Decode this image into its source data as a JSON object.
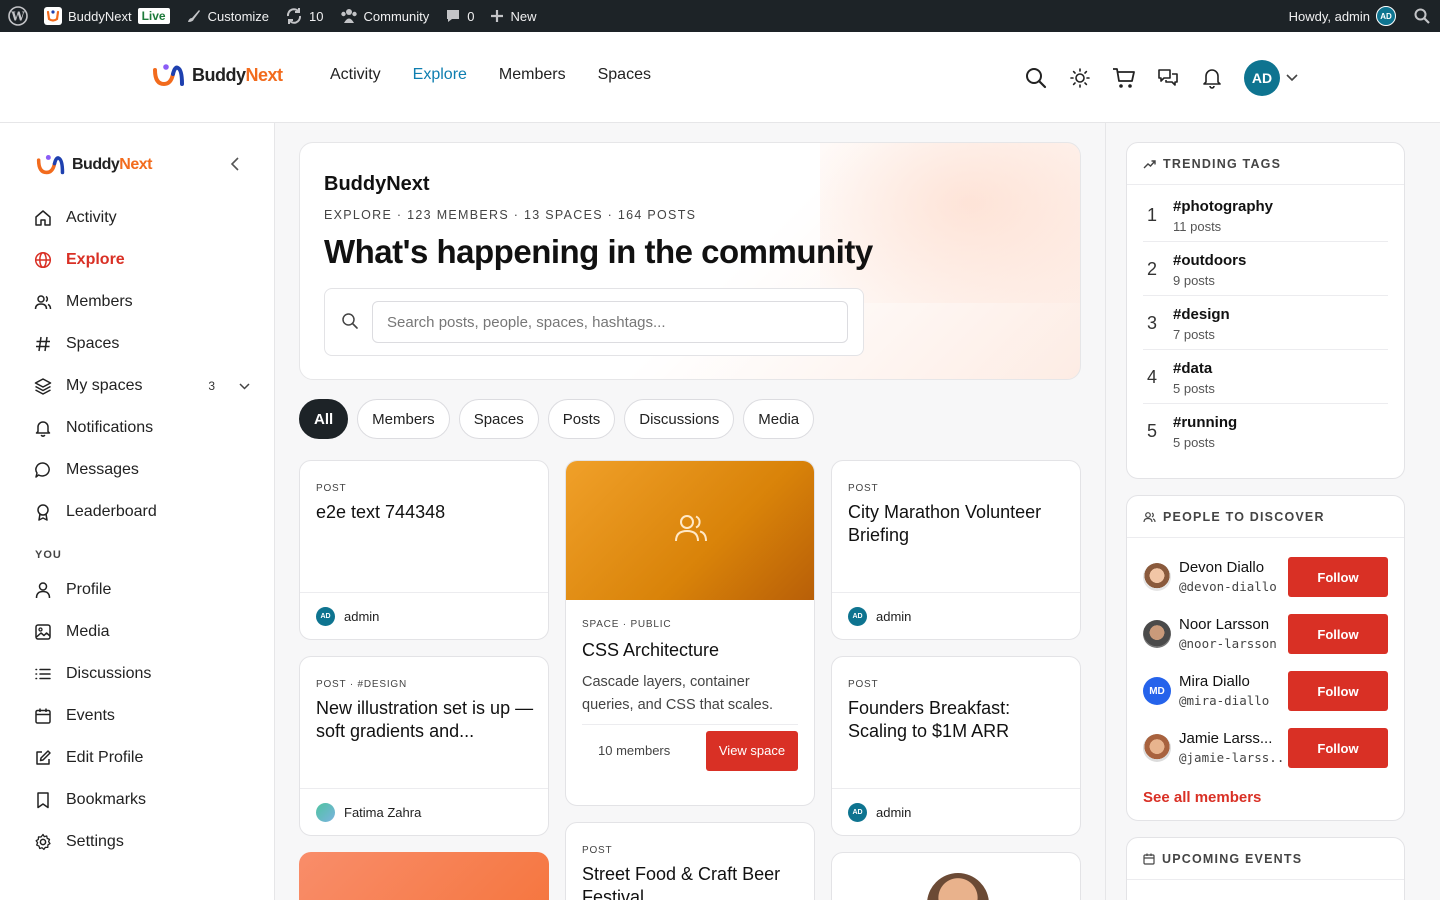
{
  "adminbar": {
    "site_name": "BuddyNext",
    "live": "Live",
    "customize": "Customize",
    "updates": "10",
    "community": "Community",
    "comments": "0",
    "new": "New",
    "howdy": "Howdy, admin",
    "avatar_initials": "AD"
  },
  "header": {
    "logo_part1": "Buddy",
    "logo_part2": "Next",
    "nav": [
      {
        "label": "Activity",
        "active": false
      },
      {
        "label": "Explore",
        "active": true
      },
      {
        "label": "Members",
        "active": false
      },
      {
        "label": "Spaces",
        "active": false
      }
    ],
    "avatar_initials": "AD"
  },
  "sidebar": {
    "logo_part1": "Buddy",
    "logo_part2": "Next",
    "main_items": [
      {
        "label": "Activity",
        "icon": "home-icon"
      },
      {
        "label": "Explore",
        "icon": "globe-icon",
        "active": true
      },
      {
        "label": "Members",
        "icon": "users-icon"
      },
      {
        "label": "Spaces",
        "icon": "hash-icon"
      },
      {
        "label": "My spaces",
        "icon": "layers-icon",
        "count": "3"
      },
      {
        "label": "Notifications",
        "icon": "bell-icon"
      },
      {
        "label": "Messages",
        "icon": "chat-icon"
      },
      {
        "label": "Leaderboard",
        "icon": "award-icon"
      }
    ],
    "you_label": "YOU",
    "you_items": [
      {
        "label": "Profile",
        "icon": "user-icon"
      },
      {
        "label": "Media",
        "icon": "image-icon"
      },
      {
        "label": "Discussions",
        "icon": "list-icon"
      },
      {
        "label": "Events",
        "icon": "calendar-icon"
      },
      {
        "label": "Edit Profile",
        "icon": "edit-icon"
      },
      {
        "label": "Bookmarks",
        "icon": "bookmark-icon"
      },
      {
        "label": "Settings",
        "icon": "gear-icon"
      }
    ]
  },
  "hero": {
    "brand": "BuddyNext",
    "meta": "EXPLORE · 123 MEMBERS · 13 SPACES · 164 POSTS",
    "title": "What's happening in the community",
    "search_placeholder": "Search posts, people, spaces, hashtags..."
  },
  "filters": [
    "All",
    "Members",
    "Spaces",
    "Posts",
    "Discussions",
    "Media"
  ],
  "cards": {
    "c1": {
      "kicker": "POST",
      "title": "e2e text 744348",
      "author": "admin",
      "author_initials": "AD"
    },
    "c2": {
      "kicker": "POST · #DESIGN",
      "title": "New illustration set is up — soft gradients and...",
      "author": "Fatima Zahra"
    },
    "space": {
      "kicker": "SPACE · PUBLIC",
      "title": "CSS Architecture",
      "desc": "Cascade layers, container queries, and CSS that scales.",
      "members": "10 members",
      "button": "View space"
    },
    "c4": {
      "kicker": "POST",
      "title": "Street Food & Craft Beer Festival"
    },
    "c5": {
      "kicker": "POST",
      "title": "City Marathon Volunteer Briefing",
      "author": "admin",
      "author_initials": "AD"
    },
    "c6": {
      "kicker": "POST",
      "title": "Founders Breakfast: Scaling to $1M ARR",
      "author": "admin",
      "author_initials": "AD"
    }
  },
  "trending": {
    "title": "TRENDING TAGS",
    "tags": [
      {
        "rank": "1",
        "name": "#photography",
        "count": "11 posts"
      },
      {
        "rank": "2",
        "name": "#outdoors",
        "count": "9 posts"
      },
      {
        "rank": "3",
        "name": "#design",
        "count": "7 posts"
      },
      {
        "rank": "4",
        "name": "#data",
        "count": "5 posts"
      },
      {
        "rank": "5",
        "name": "#running",
        "count": "5 posts"
      }
    ]
  },
  "people": {
    "title": "PEOPLE TO DISCOVER",
    "follow_label": "Follow",
    "list": [
      {
        "name": "Devon Diallo",
        "handle": "@devon-diallo"
      },
      {
        "name": "Noor Larsson",
        "handle": "@noor-larsson"
      },
      {
        "name": "Mira Diallo",
        "handle": "@mira-diallo",
        "initials": "MD"
      },
      {
        "name": "Jamie Larss...",
        "handle": "@jamie-larss..."
      }
    ],
    "see_all": "See all members"
  },
  "events": {
    "title": "UPCOMING EVENTS"
  },
  "colors": {
    "accent": "#d93025",
    "brand_orange": "#f26b1d",
    "link_blue": "#0e7eb0",
    "avatar_teal": "#0e7490"
  }
}
